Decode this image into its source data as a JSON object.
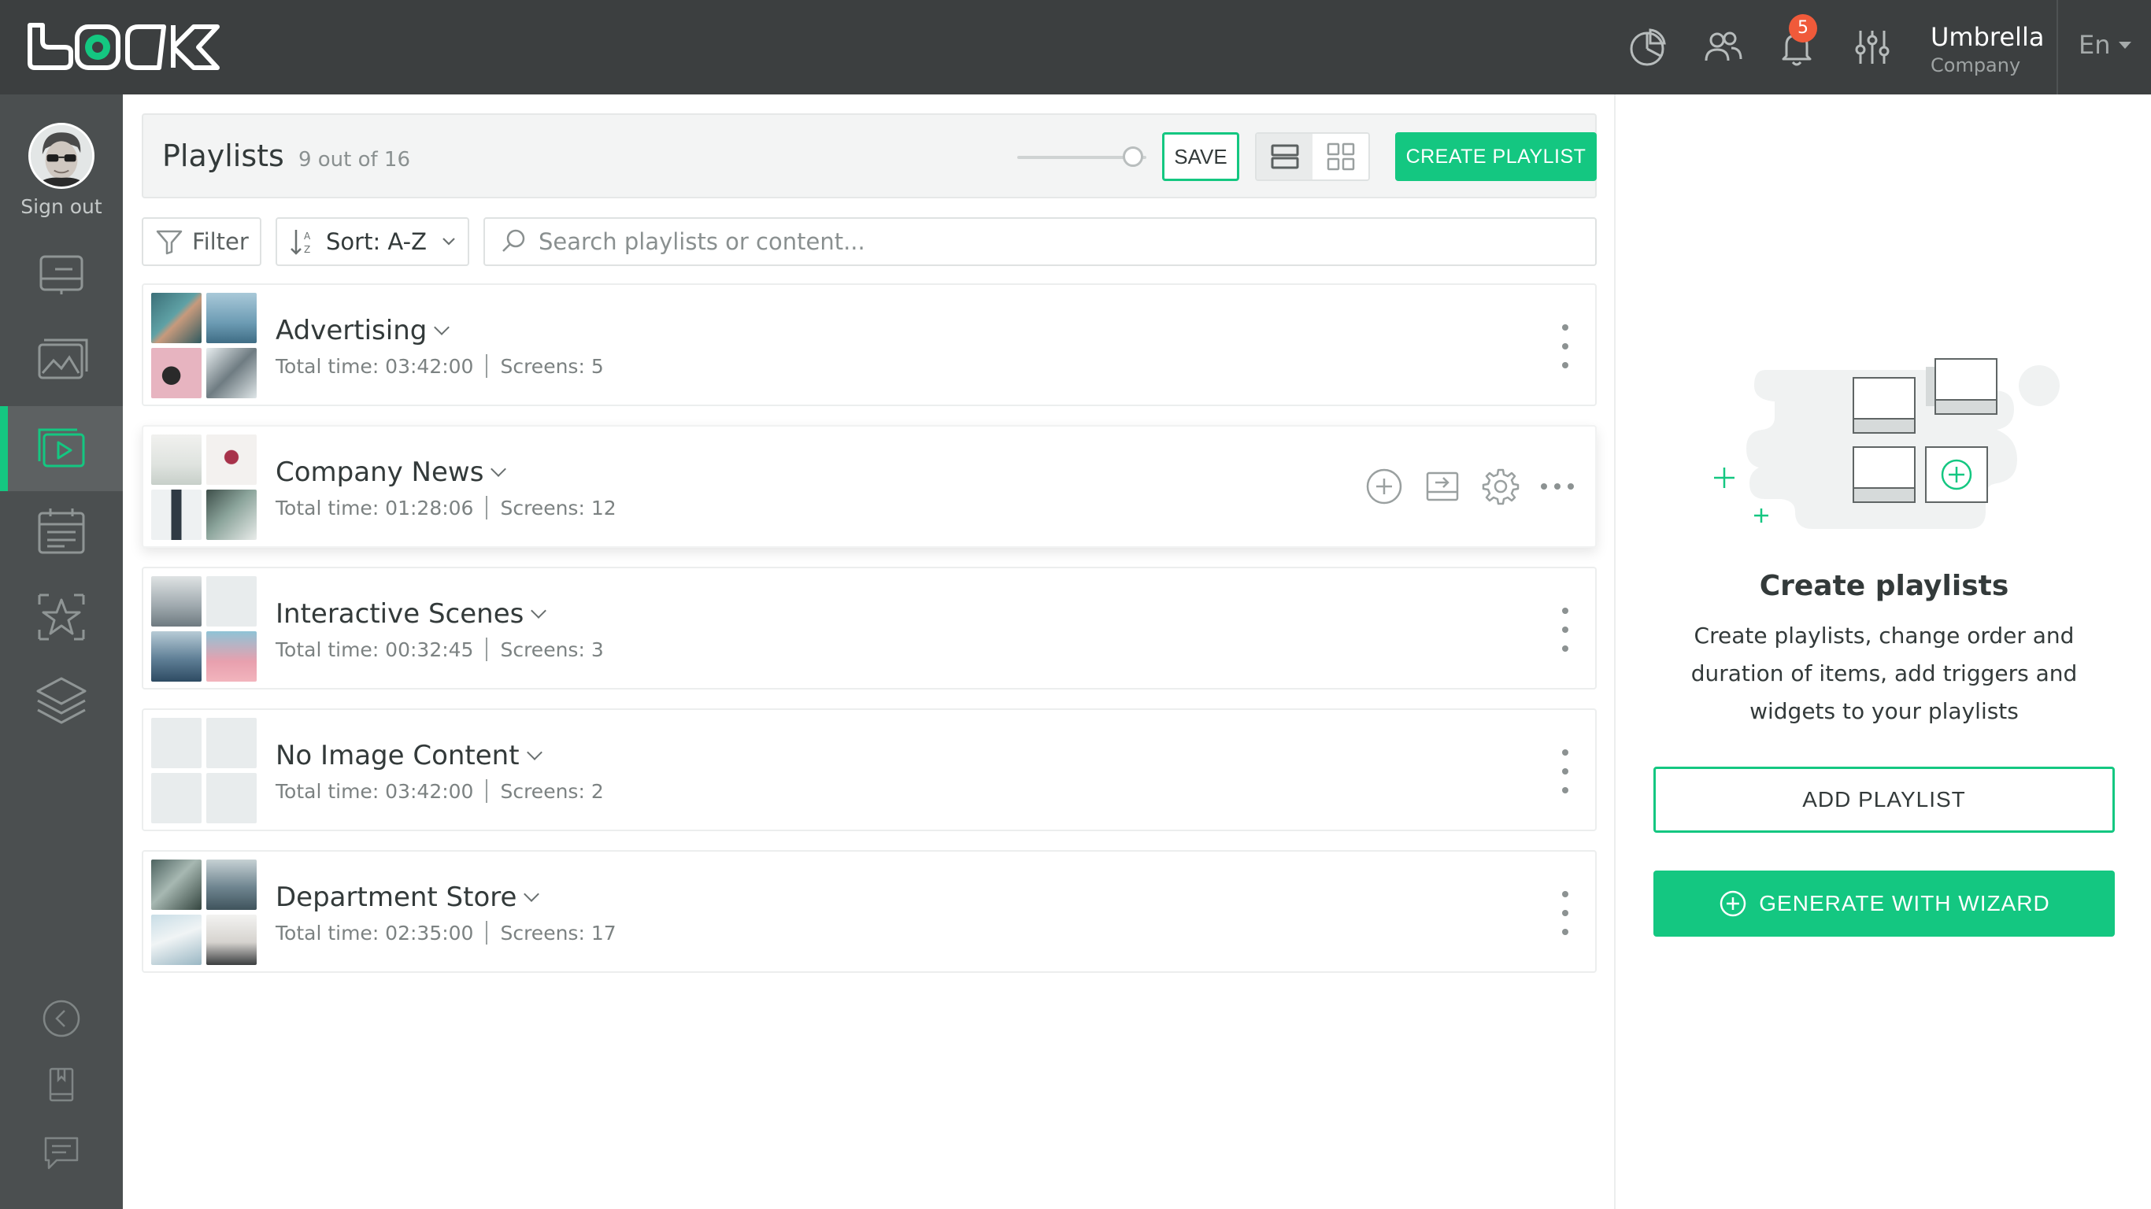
{
  "topbar": {
    "icons": [
      "analytics-icon",
      "users-icon",
      "notifications-icon",
      "settings-sliders-icon"
    ],
    "notifications_count": "5",
    "company_name": "Umbrella",
    "company_sub": "Company",
    "language": "En"
  },
  "sidebar": {
    "sign_out": "Sign out",
    "nav": [
      "screens-icon",
      "media-icon",
      "playlists-icon",
      "schedule-icon",
      "widgets-icon",
      "layers-icon"
    ],
    "active": "playlists-icon",
    "bottom": [
      "collapse-icon",
      "docs-icon",
      "chat-icon"
    ]
  },
  "header": {
    "title": "Playlists",
    "count": "9 out of 16",
    "save_label": "SAVE",
    "create_label": "CREATE PLAYLIST"
  },
  "toolbar": {
    "filter_label": "Filter",
    "sort_label": "Sort: A-Z",
    "search_placeholder": "Search playlists or content..."
  },
  "playlists": [
    {
      "name": "Advertising",
      "time": "Total time: 03:42:00",
      "screens": "Screens: 5"
    },
    {
      "name": "Company News",
      "time": "Total time: 01:28:06",
      "screens": "Screens: 12"
    },
    {
      "name": "Interactive Scenes",
      "time": "Total time: 00:32:45",
      "screens": "Screens: 3"
    },
    {
      "name": "No Image Content",
      "time": "Total time: 03:42:00",
      "screens": "Screens: 2"
    },
    {
      "name": "Department Store",
      "time": "Total time: 02:35:00",
      "screens": "Screens: 17"
    }
  ],
  "right_panel": {
    "title": "Create playlists",
    "description": "Create playlists, change order and duration of items, add triggers and widgets to your playlists",
    "add_label": "ADD PLAYLIST",
    "wizard_label": "GENERATE WITH WIZARD"
  },
  "colors": {
    "accent": "#14c781",
    "topbar": "#3c3f40",
    "sidebar": "#4b4f50",
    "badge": "#f05a3a"
  }
}
